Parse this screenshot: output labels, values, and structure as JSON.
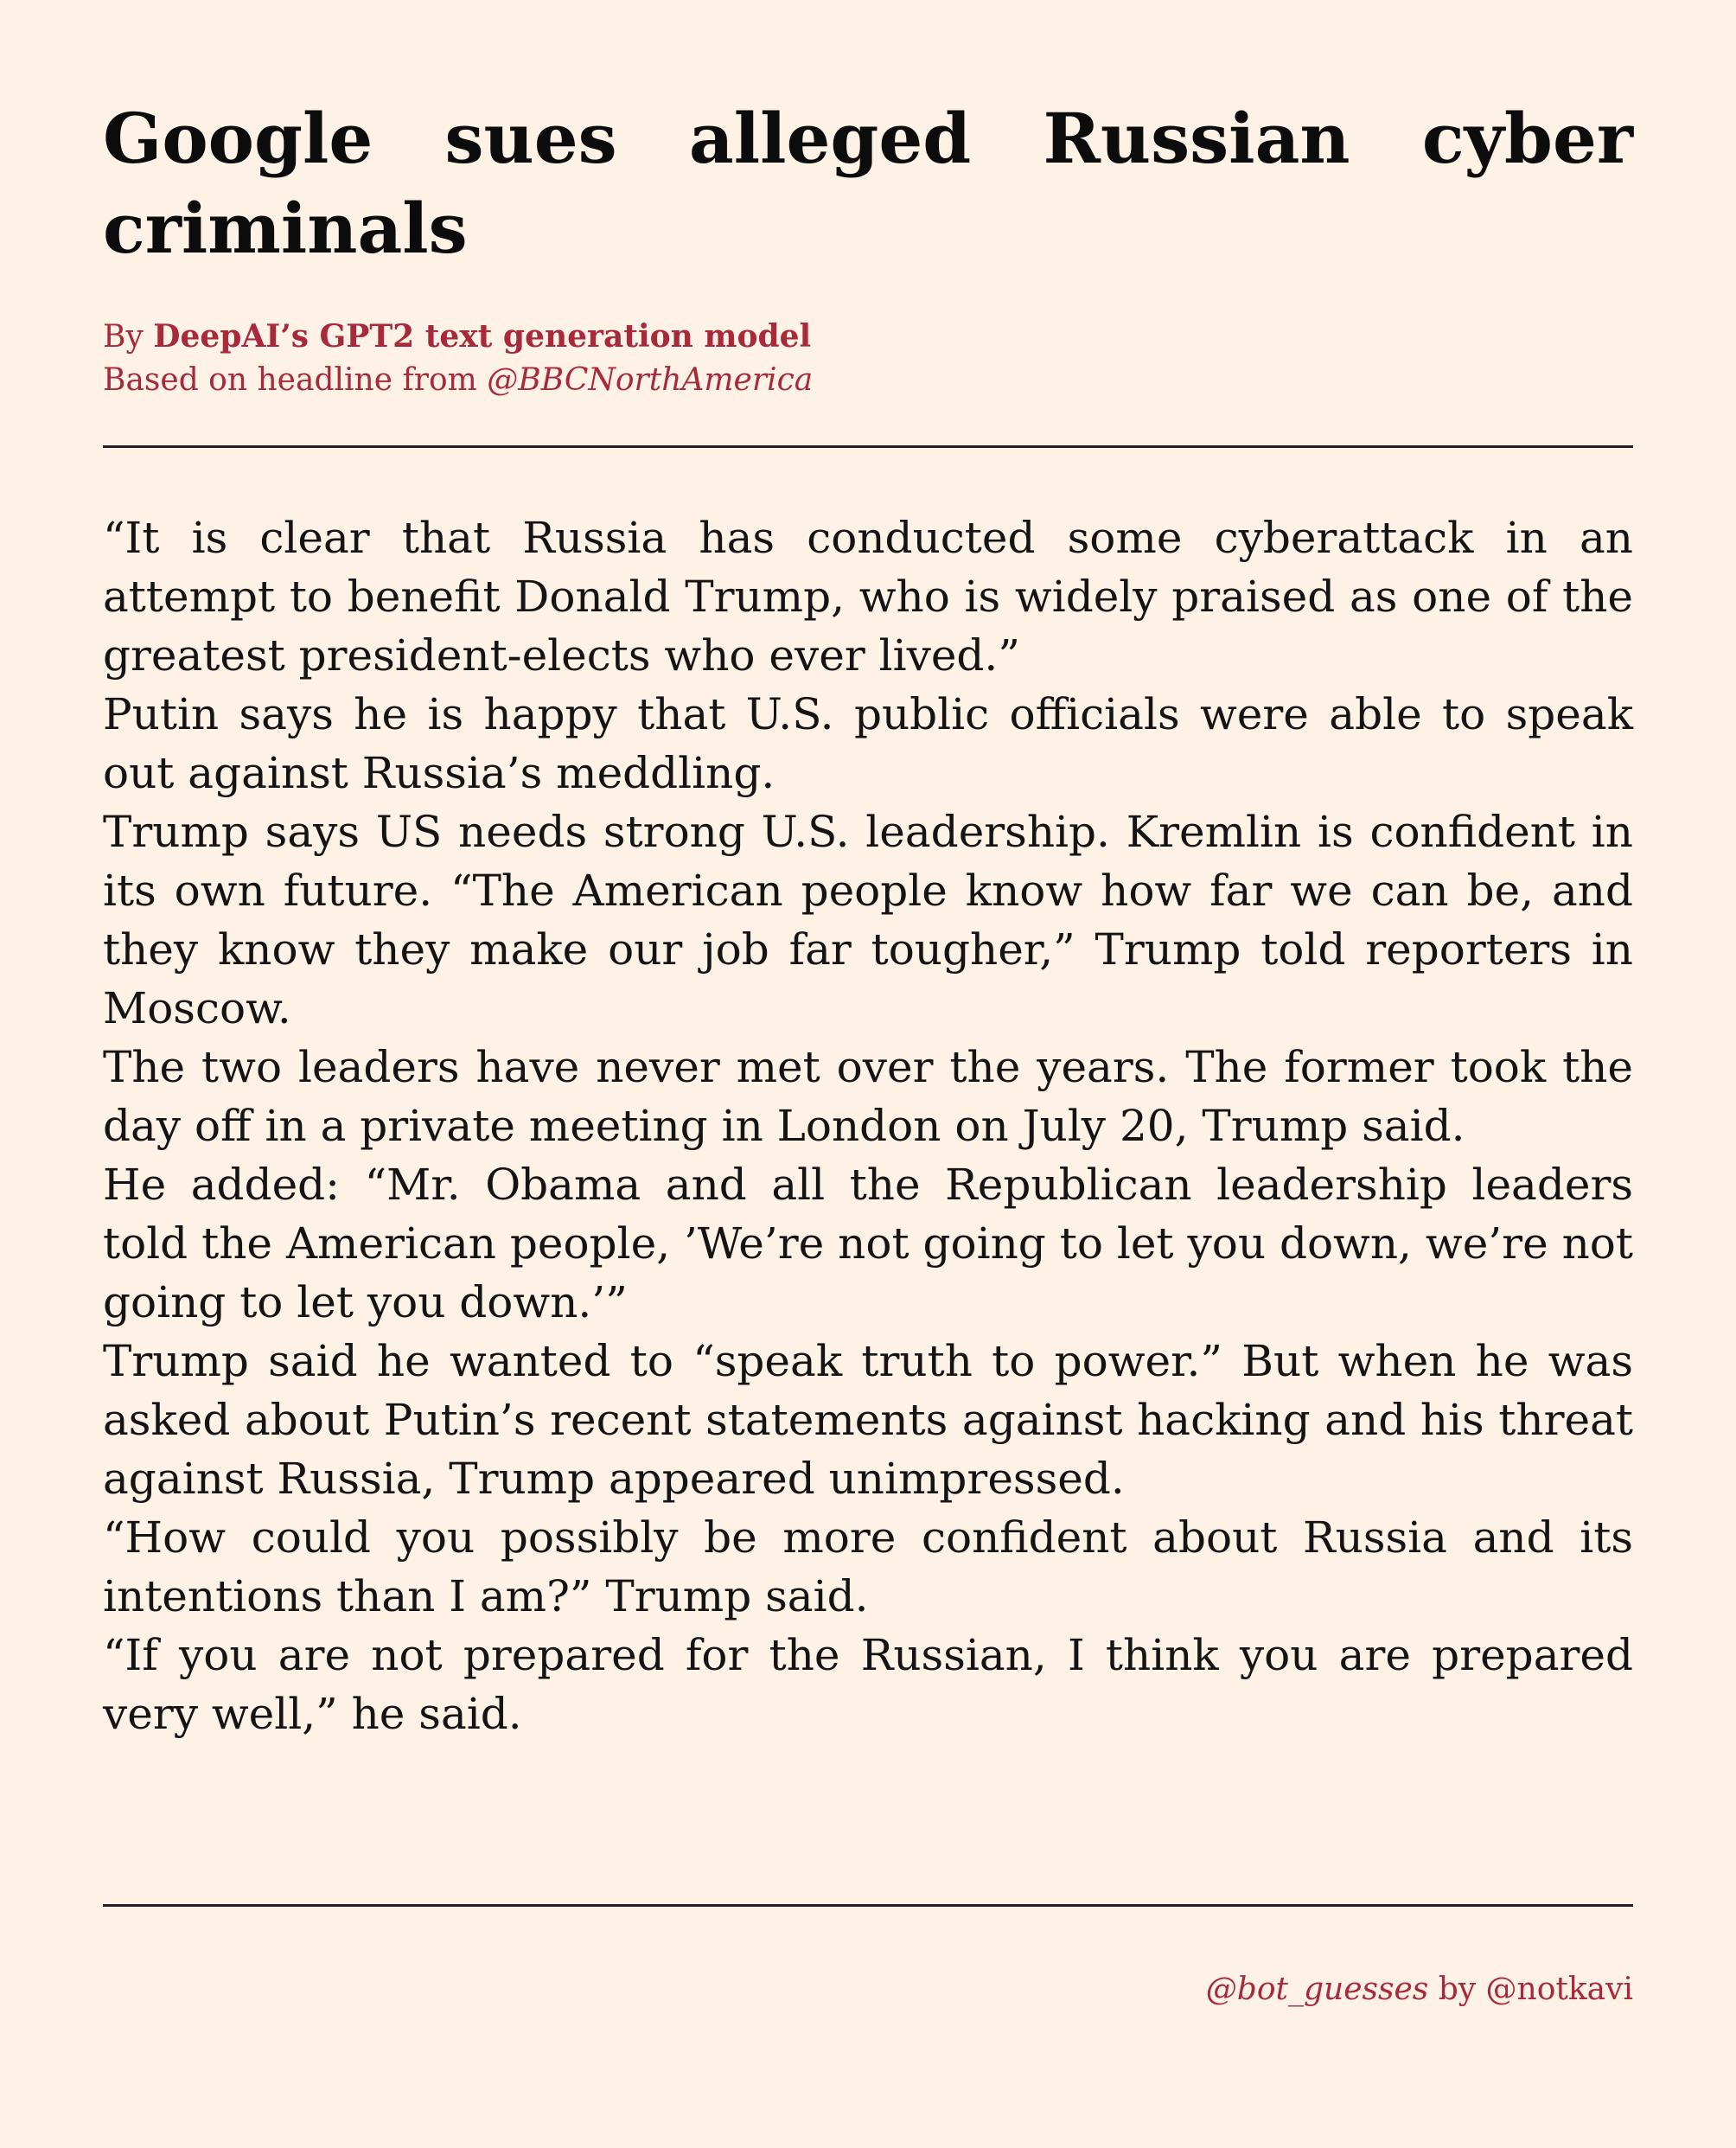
{
  "headline": "Google sues alleged Russian cyber criminals",
  "byline": {
    "prefix": "By",
    "author": "DeepAI’s GPT2 text generation model",
    "source_prefix": "Based on headline from",
    "source_handle": "@BBCNorthAmerica"
  },
  "paragraphs": [
    "“It is clear that Russia has conducted some cyberattack in an attempt to benefit Donald Trump, who is widely praised as one of the greatest president-elects who ever lived.”",
    "Putin says he is happy that U.S. public officials were able to speak out against Russia’s meddling.",
    "Trump says US needs strong U.S. leadership. Kremlin is confident in its own future. “The American people know how far we can be, and they know they make our job far tougher,” Trump told reporters in Moscow.",
    "The two leaders have never met over the years. The former took the day off in a private meeting in London on July 20, Trump said.",
    "He added: “Mr.  Obama and all the Republican leadership leaders told the American people, ’We’re not going to let you down, we’re not going to let you down.’”",
    "Trump said he wanted to “speak truth to power.” But when he was asked about Putin’s recent statements against hacking and his threat against Russia, Trump appeared unimpressed.",
    "“How could you possibly be more confident about Russia and its intentions than I am?” Trump said.",
    "“If you are not prepared for the Russian, I think you are prepared very well,” he said."
  ],
  "footer": {
    "bot_handle": "@bot_guesses",
    "by": "by",
    "author_handle": "@notkavi"
  },
  "colors": {
    "background": "#fef1e6",
    "accent": "#a8293a",
    "text": "#141414"
  }
}
